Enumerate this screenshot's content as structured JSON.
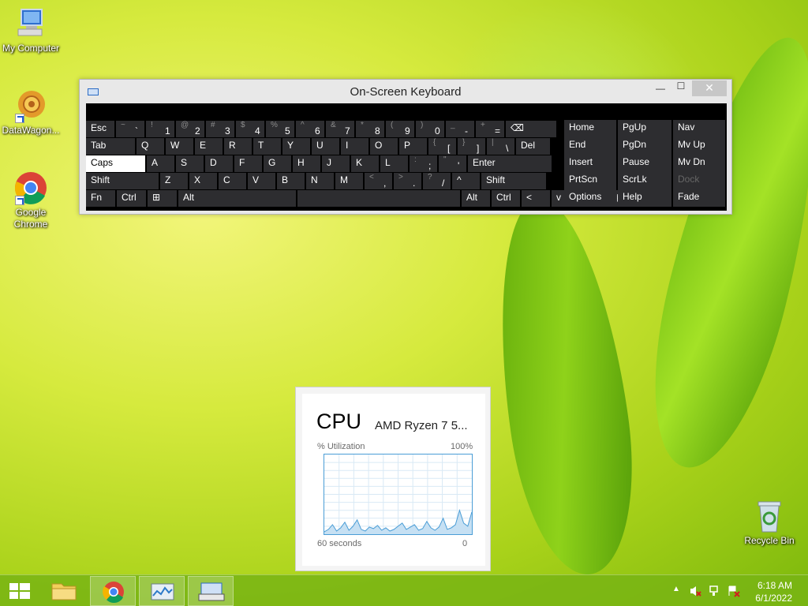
{
  "desktop": {
    "icons": [
      {
        "label": "My Computer"
      },
      {
        "label": "DataWagon..."
      },
      {
        "label": "Google Chrome"
      }
    ],
    "recycle_bin": "Recycle Bin"
  },
  "osk": {
    "title": "On-Screen Keyboard",
    "minimize": "—",
    "maximize": "☐",
    "close": "✕",
    "row1": [
      {
        "main": "Esc"
      },
      {
        "sub": "~",
        "main": "`"
      },
      {
        "sub": "!",
        "main": "1"
      },
      {
        "sub": "@",
        "main": "2"
      },
      {
        "sub": "#",
        "main": "3"
      },
      {
        "sub": "$",
        "main": "4"
      },
      {
        "sub": "%",
        "main": "5"
      },
      {
        "sub": "^",
        "main": "6"
      },
      {
        "sub": "&",
        "main": "7"
      },
      {
        "sub": "*",
        "main": "8"
      },
      {
        "sub": "(",
        "main": "9"
      },
      {
        "sub": ")",
        "main": "0"
      },
      {
        "sub": "_",
        "main": "-"
      },
      {
        "sub": "+",
        "main": "="
      },
      {
        "main": "⌫"
      }
    ],
    "row2": [
      {
        "main": "Tab"
      },
      {
        "main": "Q"
      },
      {
        "main": "W"
      },
      {
        "main": "E"
      },
      {
        "main": "R"
      },
      {
        "main": "T"
      },
      {
        "main": "Y"
      },
      {
        "main": "U"
      },
      {
        "main": "I"
      },
      {
        "main": "O"
      },
      {
        "main": "P"
      },
      {
        "sub": "{",
        "main": "["
      },
      {
        "sub": "}",
        "main": "]"
      },
      {
        "sub": "|",
        "main": "\\"
      },
      {
        "main": "Del"
      }
    ],
    "row3": [
      {
        "main": "Caps"
      },
      {
        "main": "A"
      },
      {
        "main": "S"
      },
      {
        "main": "D"
      },
      {
        "main": "F"
      },
      {
        "main": "G"
      },
      {
        "main": "H"
      },
      {
        "main": "J"
      },
      {
        "main": "K"
      },
      {
        "main": "L"
      },
      {
        "sub": ":",
        "main": ";"
      },
      {
        "sub": "\"",
        "main": "'"
      },
      {
        "main": "Enter"
      }
    ],
    "row4": [
      {
        "main": "Shift"
      },
      {
        "main": "Z"
      },
      {
        "main": "X"
      },
      {
        "main": "C"
      },
      {
        "main": "V"
      },
      {
        "main": "B"
      },
      {
        "main": "N"
      },
      {
        "main": "M"
      },
      {
        "sub": "<",
        "main": ","
      },
      {
        "sub": ">",
        "main": "."
      },
      {
        "sub": "?",
        "main": "/"
      },
      {
        "main": "^"
      },
      {
        "main": "Shift"
      }
    ],
    "row5": [
      {
        "main": "Fn"
      },
      {
        "main": "Ctrl"
      },
      {
        "main": "⊞"
      },
      {
        "main": "Alt"
      },
      {
        "main": ""
      },
      {
        "main": "Alt"
      },
      {
        "main": "Ctrl"
      },
      {
        "main": "<"
      },
      {
        "main": "v"
      },
      {
        "main": ">"
      },
      {
        "main": "▤"
      }
    ],
    "nav": [
      [
        "Home",
        "PgUp",
        "Nav"
      ],
      [
        "End",
        "PgDn",
        "Mv Up"
      ],
      [
        "Insert",
        "Pause",
        "Mv Dn"
      ],
      [
        "PrtScn",
        "ScrLk",
        "Dock"
      ],
      [
        "Options",
        "Help",
        "Fade"
      ]
    ]
  },
  "cpu": {
    "title": "CPU",
    "model": "AMD Ryzen 7 5...",
    "utilization_label": "% Utilization",
    "max_label": "100%",
    "time_label": "60 seconds",
    "min_label": "0",
    "samples": [
      3,
      6,
      12,
      4,
      8,
      15,
      5,
      10,
      18,
      6,
      4,
      9,
      7,
      11,
      5,
      8,
      4,
      6,
      10,
      14,
      6,
      9,
      12,
      5,
      7,
      16,
      8,
      5,
      9,
      20,
      6,
      8,
      12,
      30,
      14,
      10,
      28
    ]
  },
  "taskbar": {
    "time": "6:18 AM",
    "date": "6/1/2022",
    "tray_up": "▲"
  },
  "colors": {
    "taskbar": "#7cb814",
    "key_bg": "#2d2d30",
    "graph_line": "#4a9dd6"
  }
}
